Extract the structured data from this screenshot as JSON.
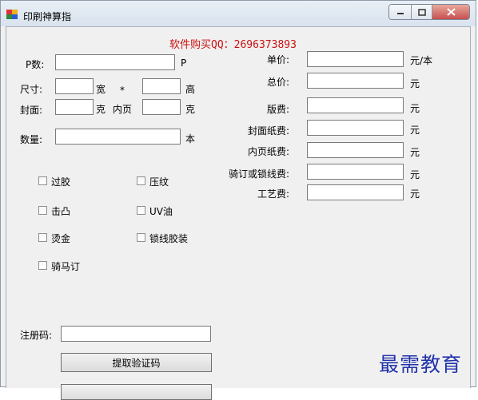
{
  "window": {
    "title": "印刷神算指"
  },
  "promo": {
    "text": "软件购买QQ：2696373893",
    "color": "#cc1111"
  },
  "left": {
    "p_label": "P数:",
    "p_unit": "P",
    "size_label": "尺寸:",
    "width_unit": "宽",
    "times": "*",
    "height_unit": "高",
    "cover_label": "封面:",
    "cover_unit": "克",
    "inner_label": "内页",
    "inner_unit": "克",
    "qty_label": "数量:",
    "qty_unit": "本"
  },
  "right": {
    "unit_price": {
      "label": "单价:",
      "unit": "元/本"
    },
    "total_price": {
      "label": "总价:",
      "unit": "元"
    },
    "plate_fee": {
      "label": "版费:",
      "unit": "元"
    },
    "cover_paper_fee": {
      "label": "封面纸费:",
      "unit": "元"
    },
    "inner_paper_fee": {
      "label": "内页纸费:",
      "unit": "元"
    },
    "binding_fee": {
      "label": "骑订或锁线费:",
      "unit": "元"
    },
    "craft_fee": {
      "label": "工艺费:",
      "unit": "元"
    }
  },
  "options": {
    "laminate": "过胶",
    "emboss_pattern": "压纹",
    "deboss": "击凸",
    "uv_oil": "UV油",
    "gold_foil": "烫金",
    "thread_binding": "锁线胶装",
    "saddle_stitch": "骑马订"
  },
  "registration": {
    "label": "注册码:",
    "button": "提取验证码"
  },
  "watermark": {
    "text": "最需教育",
    "color": "#2233aa"
  }
}
